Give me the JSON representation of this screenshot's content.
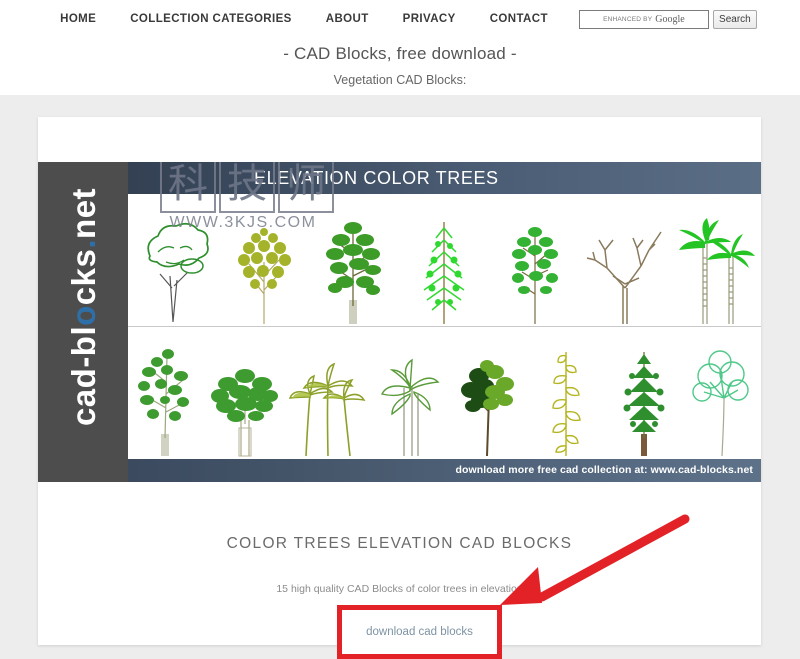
{
  "nav": {
    "items": [
      {
        "label": "HOME",
        "name": "nav-home"
      },
      {
        "label": "COLLECTION CATEGORIES",
        "name": "nav-collection-categories"
      },
      {
        "label": "ABOUT",
        "name": "nav-about"
      },
      {
        "label": "PRIVACY",
        "name": "nav-privacy"
      },
      {
        "label": "CONTACT",
        "name": "nav-contact"
      }
    ]
  },
  "search": {
    "enhanced_by": "ENHANCED BY",
    "provider": "Google",
    "placeholder": "",
    "value": "",
    "button_label": "Search"
  },
  "header": {
    "title": "- CAD Blocks, free download -",
    "subtitle": "Vegetation CAD Blocks:"
  },
  "preview": {
    "banner_title": "ELEVATION COLOR TREES",
    "side_brand": {
      "part1": "cad-bl",
      "dot": "o",
      "part2": "cks",
      "period": ".",
      "part3": "net"
    },
    "footer_note": "download more free cad collection at: www.cad-blocks.net",
    "watermark": {
      "chars": [
        "科",
        "技",
        "师"
      ],
      "url": "WWW.3KJS.COM"
    },
    "row1": [
      {
        "name": "tree-broadleaf-outline",
        "color": "#2f8f2f"
      },
      {
        "name": "tree-olive-foliage",
        "color": "#9aa81f"
      },
      {
        "name": "tree-dense-green",
        "color": "#3d9b28"
      },
      {
        "name": "tree-conifer-bright",
        "color": "#2fd92f"
      },
      {
        "name": "tree-maple-small",
        "color": "#33b233"
      },
      {
        "name": "tree-bare-branches",
        "color": "#8a7a5c"
      },
      {
        "name": "tree-palm-pair",
        "color": "#23c423"
      }
    ],
    "row2": [
      {
        "name": "tree-sparse-birch",
        "color": "#3e9b2f"
      },
      {
        "name": "tree-round-bush",
        "color": "#3e9b2f"
      },
      {
        "name": "tree-palm-cluster",
        "color": "#86a82a"
      },
      {
        "name": "tree-banana-outline",
        "color": "#5a9b3a"
      },
      {
        "name": "tree-dark-oak",
        "color": "#1d4d14"
      },
      {
        "name": "tree-tall-yellow",
        "color": "#b5b520"
      },
      {
        "name": "tree-spruce",
        "color": "#2f8f2f"
      },
      {
        "name": "tree-ginkgo-outline",
        "color": "#4fc98a"
      }
    ]
  },
  "section": {
    "title": "COLOR TREES ELEVATION CAD BLOCKS",
    "description": "15 high quality CAD Blocks of color trees in elevation",
    "download_label": "download cad blocks",
    "highlight_color": "#e32227",
    "link_color": "#7e93a4"
  }
}
